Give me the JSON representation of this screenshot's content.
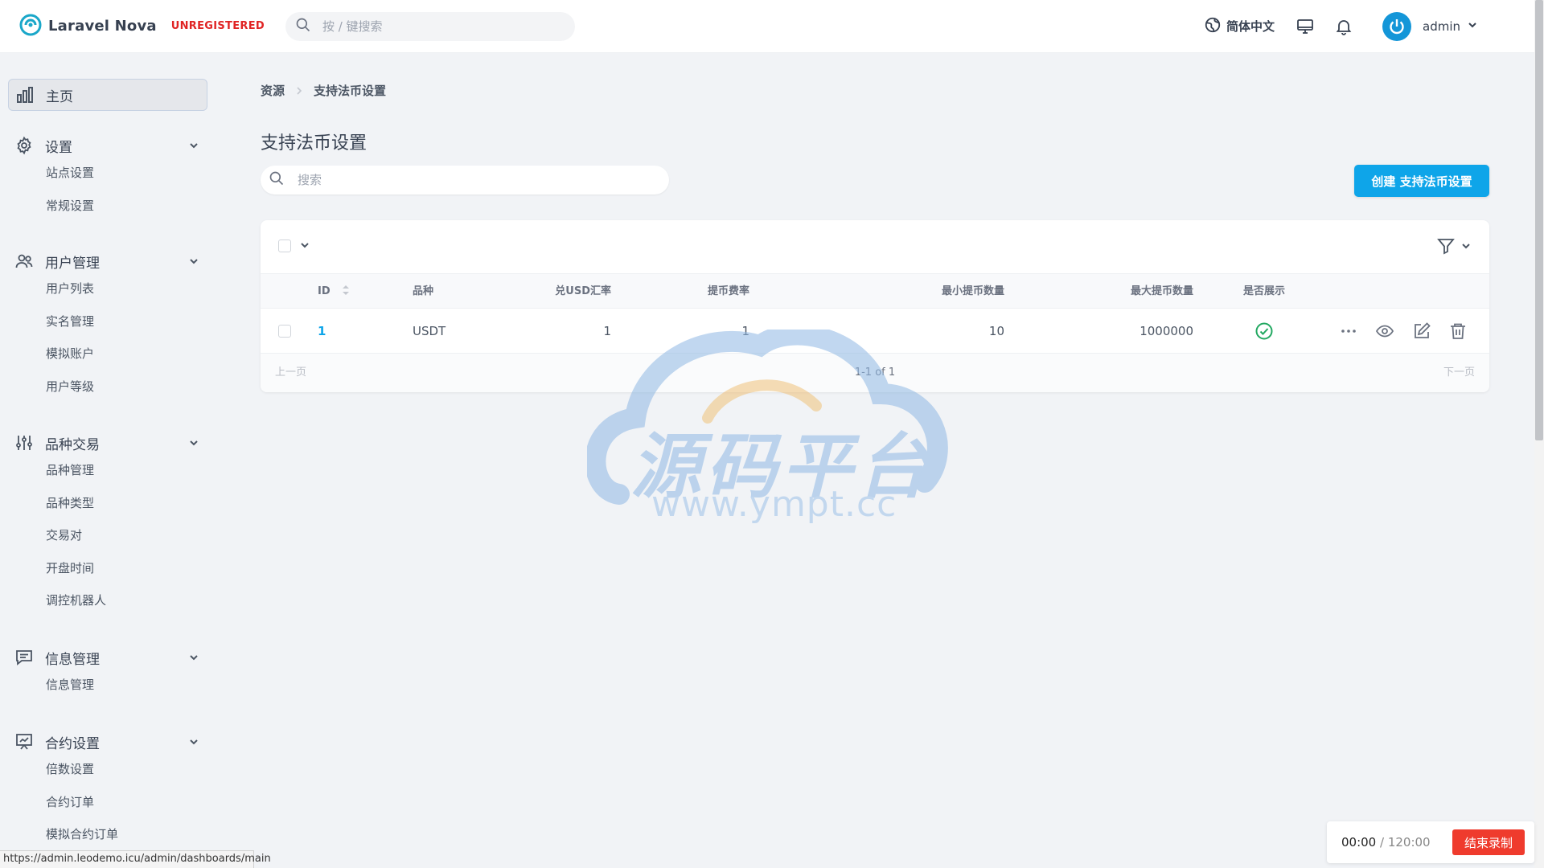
{
  "topbar": {
    "brand_name": "Laravel Nova",
    "badge": "UNREGISTERED",
    "search_placeholder": "按 / 键搜索",
    "language": "简体中文",
    "user": "admin"
  },
  "sidebar": {
    "home": "主页",
    "groups": [
      {
        "label": "设置",
        "icon": "gear-icon",
        "items": [
          "站点设置",
          "常规设置"
        ]
      },
      {
        "label": "用户管理",
        "icon": "users-icon",
        "items": [
          "用户列表",
          "实名管理",
          "模拟账户",
          "用户等级"
        ]
      },
      {
        "label": "品种交易",
        "icon": "sliders-icon",
        "items": [
          "品种管理",
          "品种类型",
          "交易对",
          "开盘时间",
          "调控机器人"
        ]
      },
      {
        "label": "信息管理",
        "icon": "message-icon",
        "items": [
          "信息管理"
        ]
      },
      {
        "label": "合约设置",
        "icon": "presentation-icon",
        "items": [
          "倍数设置",
          "合约订单",
          "模拟合约订单"
        ]
      }
    ]
  },
  "status_url": "https://admin.leodemo.icu/admin/dashboards/main",
  "main": {
    "breadcrumb": [
      "资源",
      "支持法币设置"
    ],
    "title": "支持法币设置",
    "search_placeholder": "搜索",
    "create_button": "创建 支持法币设置",
    "columns": [
      "ID",
      "品种",
      "兑USD汇率",
      "提币费率",
      "最小提币数量",
      "最大提币数量",
      "是否展示"
    ],
    "rows": [
      {
        "id": "1",
        "symbol": "USDT",
        "rate": "1",
        "fee": "1",
        "min": "10",
        "max": "1000000",
        "show": true
      }
    ],
    "pager": {
      "prev": "上一页",
      "info": "1-1 of 1",
      "next": "下一页"
    }
  },
  "watermark": {
    "cn": "源码平台",
    "url": "www.ympt.cc"
  },
  "recorder": {
    "elapsed": "00:00",
    "separator": " / ",
    "total": "120:00",
    "stop": "结束录制"
  },
  "colors": {
    "accent": "#0ea5e9",
    "success": "#22a861",
    "danger": "#ef3b2d",
    "brand_badge": "#e02424"
  }
}
